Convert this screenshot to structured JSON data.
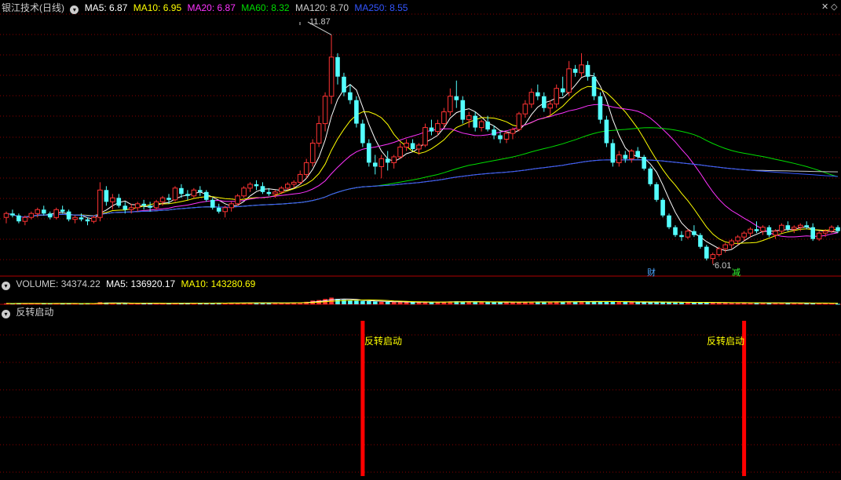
{
  "header": {
    "title": "银江技术(日线)",
    "ma": [
      {
        "label": "MA5:",
        "value": "6.87",
        "color": "#ffffff"
      },
      {
        "label": "MA10:",
        "value": "6.95",
        "color": "#ffff00"
      },
      {
        "label": "MA20:",
        "value": "6.87",
        "color": "#ff33ff"
      },
      {
        "label": "MA60:",
        "value": "8.32",
        "color": "#00dd00"
      },
      {
        "label": "MA120:",
        "value": "8.70",
        "color": "#cccccc"
      },
      {
        "label": "MA250:",
        "value": "8.55",
        "color": "#3355ff"
      }
    ]
  },
  "volume_header": {
    "label": "VOLUME:",
    "value": "34374.22",
    "ma5_label": "MA5:",
    "ma5_value": "136920.17",
    "ma10_label": "MA10:",
    "ma10_value": "143280.69"
  },
  "indicator_header": {
    "label": "反转启动"
  },
  "annotations": {
    "high_label": "11.87",
    "low_label": "6.01",
    "marker_cai": "财",
    "marker_jian": "减",
    "signal_text": "反转启动"
  },
  "colors": {
    "up": "#ff3333",
    "down": "#54ffff",
    "grid": "#8a0000",
    "signal": "#ff0000",
    "signal_text": "#ffff00"
  },
  "chart_data": {
    "type": "candlestick",
    "ylim": [
      5.7,
      12.4
    ],
    "candles": [
      [
        7.2,
        7.35,
        7.05,
        7.3
      ],
      [
        7.3,
        7.4,
        7.2,
        7.25
      ],
      [
        7.25,
        7.3,
        7.05,
        7.1
      ],
      [
        7.1,
        7.25,
        7.0,
        7.2
      ],
      [
        7.2,
        7.35,
        7.15,
        7.3
      ],
      [
        7.3,
        7.45,
        7.2,
        7.4
      ],
      [
        7.4,
        7.5,
        7.25,
        7.3
      ],
      [
        7.3,
        7.35,
        7.15,
        7.2
      ],
      [
        7.2,
        7.45,
        7.15,
        7.4
      ],
      [
        7.4,
        7.5,
        7.3,
        7.35
      ],
      [
        7.35,
        7.4,
        7.1,
        7.15
      ],
      [
        7.15,
        7.25,
        7.05,
        7.2
      ],
      [
        7.2,
        7.3,
        7.1,
        7.15
      ],
      [
        7.15,
        7.2,
        7.0,
        7.1
      ],
      [
        7.1,
        7.25,
        7.05,
        7.2
      ],
      [
        7.2,
        8.1,
        7.1,
        7.9
      ],
      [
        7.9,
        8.0,
        7.5,
        7.6
      ],
      [
        7.6,
        7.8,
        7.4,
        7.7
      ],
      [
        7.7,
        7.8,
        7.45,
        7.5
      ],
      [
        7.5,
        7.6,
        7.3,
        7.4
      ],
      [
        7.4,
        7.55,
        7.3,
        7.45
      ],
      [
        7.45,
        7.6,
        7.35,
        7.55
      ],
      [
        7.55,
        7.65,
        7.4,
        7.5
      ],
      [
        7.5,
        7.6,
        7.35,
        7.45
      ],
      [
        7.45,
        7.65,
        7.4,
        7.6
      ],
      [
        7.6,
        7.75,
        7.5,
        7.7
      ],
      [
        7.7,
        7.8,
        7.55,
        7.65
      ],
      [
        7.65,
        8.0,
        7.6,
        7.95
      ],
      [
        7.95,
        8.05,
        7.7,
        7.8
      ],
      [
        7.8,
        7.9,
        7.65,
        7.75
      ],
      [
        7.75,
        7.95,
        7.7,
        7.9
      ],
      [
        7.9,
        8.0,
        7.75,
        7.85
      ],
      [
        7.85,
        7.9,
        7.6,
        7.65
      ],
      [
        7.65,
        7.7,
        7.4,
        7.45
      ],
      [
        7.45,
        7.55,
        7.3,
        7.35
      ],
      [
        7.35,
        7.5,
        7.2,
        7.45
      ],
      [
        7.45,
        7.6,
        7.35,
        7.55
      ],
      [
        7.55,
        7.8,
        7.5,
        7.75
      ],
      [
        7.75,
        8.0,
        7.7,
        7.95
      ],
      [
        7.95,
        8.1,
        7.85,
        8.05
      ],
      [
        8.05,
        8.15,
        7.9,
        8.0
      ],
      [
        8.0,
        8.1,
        7.8,
        7.85
      ],
      [
        7.85,
        7.95,
        7.75,
        7.8
      ],
      [
        7.8,
        7.9,
        7.7,
        7.85
      ],
      [
        7.85,
        8.0,
        7.8,
        7.95
      ],
      [
        7.95,
        8.1,
        7.9,
        8.05
      ],
      [
        8.05,
        8.15,
        7.95,
        8.1
      ],
      [
        8.1,
        8.4,
        8.05,
        8.3
      ],
      [
        8.3,
        8.7,
        8.2,
        8.6
      ],
      [
        8.6,
        9.2,
        8.5,
        9.1
      ],
      [
        9.1,
        9.8,
        9.0,
        9.6
      ],
      [
        9.6,
        10.4,
        9.4,
        10.3
      ],
      [
        10.3,
        11.87,
        10.1,
        11.3
      ],
      [
        11.3,
        11.4,
        10.6,
        10.8
      ],
      [
        10.8,
        10.9,
        10.3,
        10.4
      ],
      [
        10.4,
        10.6,
        10.1,
        10.2
      ],
      [
        10.2,
        10.3,
        9.5,
        9.6
      ],
      [
        9.6,
        9.7,
        9.0,
        9.1
      ],
      [
        9.1,
        9.2,
        8.5,
        8.6
      ],
      [
        8.6,
        8.8,
        8.3,
        8.5
      ],
      [
        8.5,
        8.8,
        8.2,
        8.7
      ],
      [
        8.7,
        8.9,
        8.4,
        8.6
      ],
      [
        8.6,
        8.8,
        8.45,
        8.75
      ],
      [
        8.75,
        9.1,
        8.7,
        9.0
      ],
      [
        9.0,
        9.2,
        8.9,
        9.1
      ],
      [
        9.1,
        9.2,
        8.9,
        8.95
      ],
      [
        8.95,
        9.1,
        8.8,
        9.05
      ],
      [
        9.05,
        9.6,
        9.0,
        9.5
      ],
      [
        9.5,
        9.7,
        9.3,
        9.4
      ],
      [
        9.4,
        9.7,
        9.3,
        9.6
      ],
      [
        9.6,
        10.0,
        9.5,
        9.9
      ],
      [
        9.9,
        10.5,
        9.8,
        10.3
      ],
      [
        10.3,
        10.7,
        10.0,
        10.2
      ],
      [
        10.2,
        10.3,
        9.6,
        9.7
      ],
      [
        9.7,
        9.9,
        9.5,
        9.8
      ],
      [
        9.8,
        9.9,
        9.4,
        9.5
      ],
      [
        9.5,
        9.7,
        9.4,
        9.65
      ],
      [
        9.65,
        9.8,
        9.4,
        9.45
      ],
      [
        9.45,
        9.55,
        9.2,
        9.3
      ],
      [
        9.3,
        9.4,
        9.1,
        9.2
      ],
      [
        9.2,
        9.4,
        9.1,
        9.35
      ],
      [
        9.35,
        9.5,
        9.2,
        9.45
      ],
      [
        9.45,
        9.9,
        9.4,
        9.85
      ],
      [
        9.85,
        10.2,
        9.75,
        10.1
      ],
      [
        10.1,
        10.5,
        10.0,
        10.4
      ],
      [
        10.4,
        10.6,
        10.2,
        10.3
      ],
      [
        10.3,
        10.4,
        9.9,
        10.0
      ],
      [
        10.0,
        10.2,
        9.8,
        10.1
      ],
      [
        10.1,
        10.6,
        10.0,
        10.5
      ],
      [
        10.5,
        10.8,
        10.3,
        10.4
      ],
      [
        10.4,
        11.2,
        10.3,
        11.0
      ],
      [
        11.0,
        11.1,
        10.8,
        10.9
      ],
      [
        10.9,
        11.4,
        10.8,
        11.1
      ],
      [
        11.1,
        11.2,
        10.7,
        10.8
      ],
      [
        10.8,
        10.9,
        10.2,
        10.3
      ],
      [
        10.3,
        10.4,
        9.6,
        9.7
      ],
      [
        9.7,
        9.8,
        9.0,
        9.1
      ],
      [
        9.1,
        9.2,
        8.5,
        8.6
      ],
      [
        8.6,
        8.9,
        8.5,
        8.8
      ],
      [
        8.8,
        8.9,
        8.6,
        8.7
      ],
      [
        8.7,
        8.95,
        8.6,
        8.9
      ],
      [
        8.9,
        9.0,
        8.7,
        8.75
      ],
      [
        8.75,
        8.8,
        8.4,
        8.45
      ],
      [
        8.45,
        8.5,
        8.0,
        8.05
      ],
      [
        8.05,
        8.1,
        7.6,
        7.65
      ],
      [
        7.65,
        7.7,
        7.2,
        7.25
      ],
      [
        7.25,
        7.3,
        6.9,
        6.95
      ],
      [
        6.95,
        7.0,
        6.7,
        6.75
      ],
      [
        6.75,
        6.85,
        6.6,
        6.7
      ],
      [
        6.7,
        6.9,
        6.65,
        6.85
      ],
      [
        6.85,
        7.0,
        6.7,
        6.75
      ],
      [
        6.75,
        6.8,
        6.4,
        6.45
      ],
      [
        6.45,
        6.5,
        6.1,
        6.15
      ],
      [
        6.15,
        6.3,
        6.01,
        6.25
      ],
      [
        6.25,
        6.45,
        6.2,
        6.4
      ],
      [
        6.4,
        6.55,
        6.3,
        6.5
      ],
      [
        6.5,
        6.65,
        6.4,
        6.6
      ],
      [
        6.6,
        6.75,
        6.5,
        6.7
      ],
      [
        6.7,
        6.85,
        6.6,
        6.8
      ],
      [
        6.8,
        6.95,
        6.7,
        6.9
      ],
      [
        6.9,
        7.1,
        6.8,
        6.85
      ],
      [
        6.85,
        7.0,
        6.75,
        6.95
      ],
      [
        6.95,
        7.0,
        6.7,
        6.75
      ],
      [
        6.75,
        6.9,
        6.65,
        6.85
      ],
      [
        6.85,
        7.05,
        6.8,
        7.0
      ],
      [
        7.0,
        7.1,
        6.85,
        6.9
      ],
      [
        6.9,
        7.0,
        6.8,
        6.95
      ],
      [
        6.95,
        7.05,
        6.85,
        7.0
      ],
      [
        7.0,
        7.1,
        6.9,
        6.95
      ],
      [
        6.95,
        7.05,
        6.6,
        6.65
      ],
      [
        6.65,
        6.85,
        6.6,
        6.8
      ],
      [
        6.8,
        6.9,
        6.7,
        6.85
      ],
      [
        6.85,
        7.0,
        6.8,
        6.95
      ],
      [
        6.95,
        7.0,
        6.8,
        6.85
      ]
    ],
    "volume_ylim": [
      0,
      1000000
    ],
    "volume": [
      60000,
      55000,
      70000,
      50000,
      60000,
      65000,
      55000,
      60000,
      70000,
      50000,
      60000,
      55000,
      50000,
      60000,
      55000,
      150000,
      120000,
      90000,
      80000,
      70000,
      60000,
      65000,
      70000,
      60000,
      75000,
      80000,
      70000,
      90000,
      85000,
      80000,
      90000,
      80000,
      85000,
      95000,
      90000,
      80000,
      90000,
      100000,
      110000,
      120000,
      100000,
      110000,
      90000,
      95000,
      100000,
      110000,
      120000,
      140000,
      180000,
      260000,
      300000,
      380000,
      470000,
      380000,
      320000,
      280000,
      260000,
      240000,
      220000,
      200000,
      180000,
      170000,
      160000,
      170000,
      160000,
      150000,
      140000,
      170000,
      160000,
      150000,
      170000,
      200000,
      210000,
      190000,
      180000,
      170000,
      160000,
      150000,
      160000,
      150000,
      140000,
      150000,
      170000,
      180000,
      190000,
      170000,
      160000,
      170000,
      190000,
      180000,
      200000,
      190000,
      210000,
      190000,
      200000,
      210000,
      200000,
      190000,
      170000,
      160000,
      150000,
      140000,
      150000,
      160000,
      170000,
      150000,
      140000,
      130000,
      120000,
      130000,
      120000,
      130000,
      120000,
      110000,
      120000,
      110000,
      100000,
      110000,
      100000,
      110000,
      100000,
      90000,
      100000,
      95000,
      90000,
      85000,
      90000,
      85000,
      80000,
      85000,
      80000,
      85000,
      80000,
      34374
    ],
    "signals": [
      57,
      118
    ]
  }
}
